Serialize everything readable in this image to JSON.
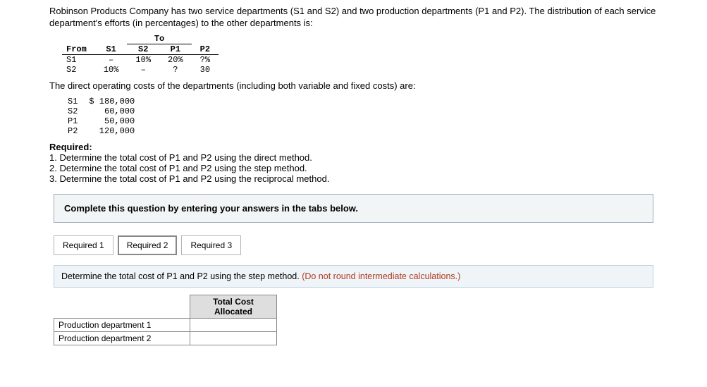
{
  "intro": "Robinson Products Company has two service departments (S1 and S2) and two production departments (P1 and P2). The distribution of each service department's efforts (in percentages) to the other departments is:",
  "dist": {
    "to_label": "To",
    "from_label": "From",
    "cols": [
      "S1",
      "S2",
      "P1",
      "P2"
    ],
    "rows": [
      {
        "label": "S1",
        "vals": [
          "–",
          "10%",
          "20%",
          "?%"
        ]
      },
      {
        "label": "S2",
        "vals": [
          "10%",
          "–",
          "?",
          "30"
        ]
      }
    ]
  },
  "costs_intro": "The direct operating costs of the departments (including both variable and fixed costs) are:",
  "costs": [
    {
      "label": "S1",
      "val": "$ 180,000"
    },
    {
      "label": "S2",
      "val": "60,000"
    },
    {
      "label": "P1",
      "val": "50,000"
    },
    {
      "label": "P2",
      "val": "120,000"
    }
  ],
  "required_label": "Required:",
  "required": [
    "1. Determine the total cost of P1 and P2 using the direct method.",
    "2. Determine the total cost of P1 and P2 using the step method.",
    "3. Determine the total cost of P1 and P2 using the reciprocal method."
  ],
  "complete_msg": "Complete this question by entering your answers in the tabs below.",
  "tabs": [
    "Required 1",
    "Required 2",
    "Required 3"
  ],
  "active_tab": 1,
  "question": {
    "main": "Determine the total cost of P1 and P2 using the step method. ",
    "note": "(Do not round intermediate calculations.)"
  },
  "answer": {
    "header": "Total Cost Allocated",
    "rows": [
      "Production department 1",
      "Production department 2"
    ]
  }
}
